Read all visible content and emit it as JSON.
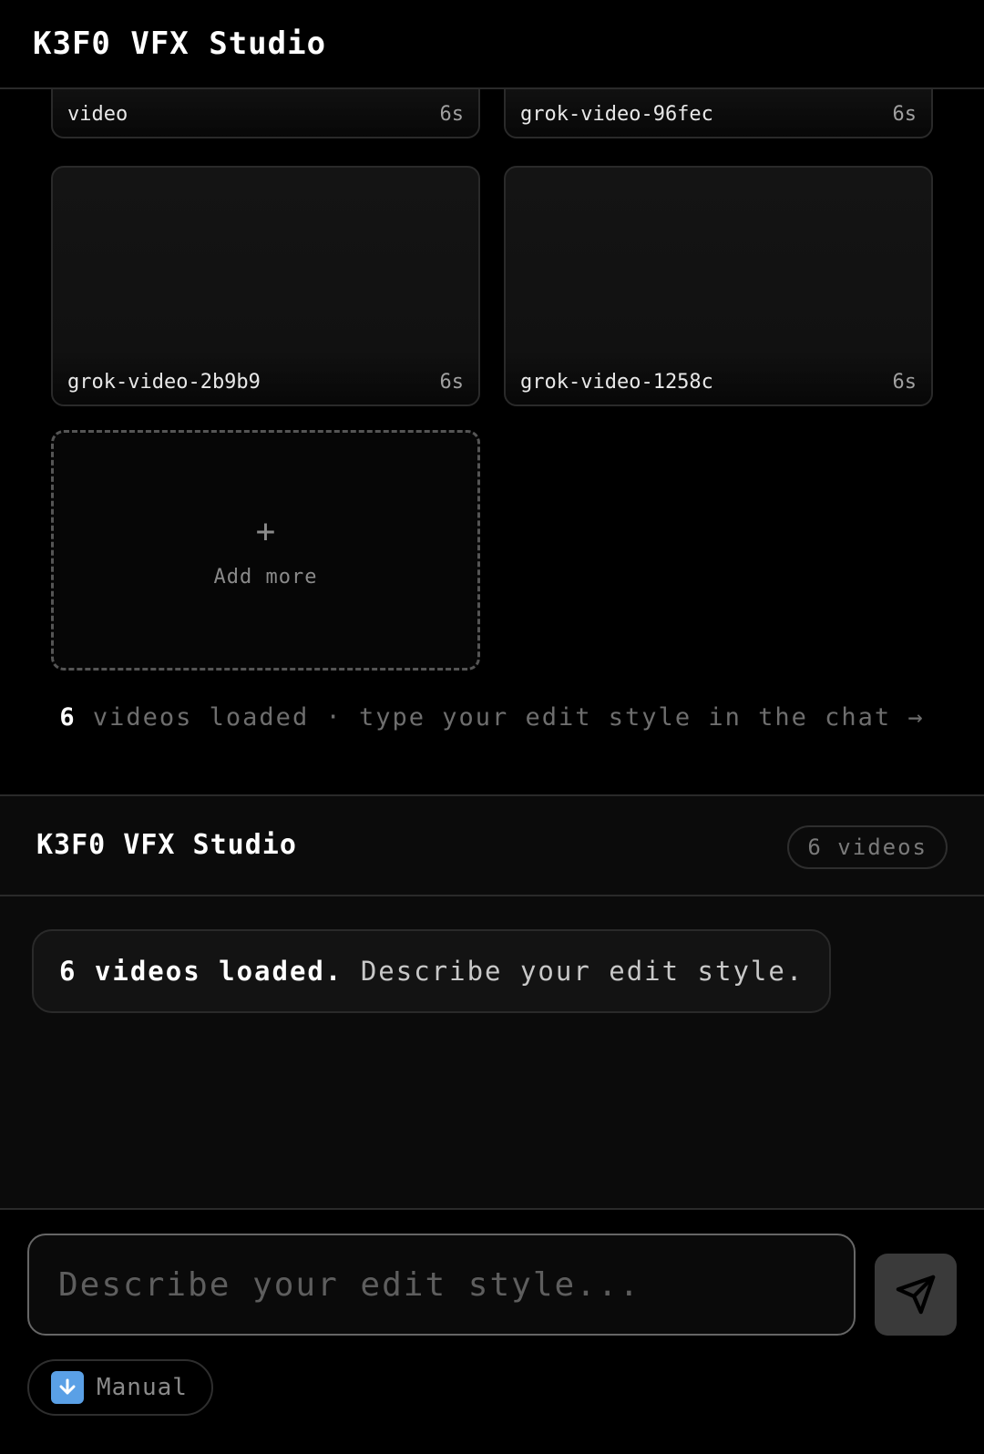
{
  "app": {
    "title": "K3F0 VFX Studio"
  },
  "gallery": {
    "videos": [
      {
        "name": "video",
        "duration": "6s"
      },
      {
        "name": "grok-video-96fec",
        "duration": "6s"
      },
      {
        "name": "grok-video-2b9b9",
        "duration": "6s"
      },
      {
        "name": "grok-video-1258c",
        "duration": "6s"
      }
    ],
    "add_more": {
      "icon": "+",
      "label": "Add more"
    },
    "hint": {
      "count": "6",
      "text": "videos loaded · type your edit style in the chat →"
    }
  },
  "chat": {
    "title": "K3F0 VFX Studio",
    "badge": "6 videos",
    "messages": [
      {
        "strong": "6 videos loaded.",
        "text": "Describe your edit style."
      }
    ],
    "input": {
      "placeholder": "Describe your edit style...",
      "value": ""
    },
    "send": {
      "icon": "send-icon"
    },
    "manual": {
      "icon": "download-arrow-icon",
      "label": "Manual"
    }
  },
  "colors": {
    "background": "#000000",
    "panel": "#0b0b0b",
    "border": "#2a2a2a",
    "send_button": "#3a3a3a",
    "download_icon": "#5aa0e6"
  }
}
